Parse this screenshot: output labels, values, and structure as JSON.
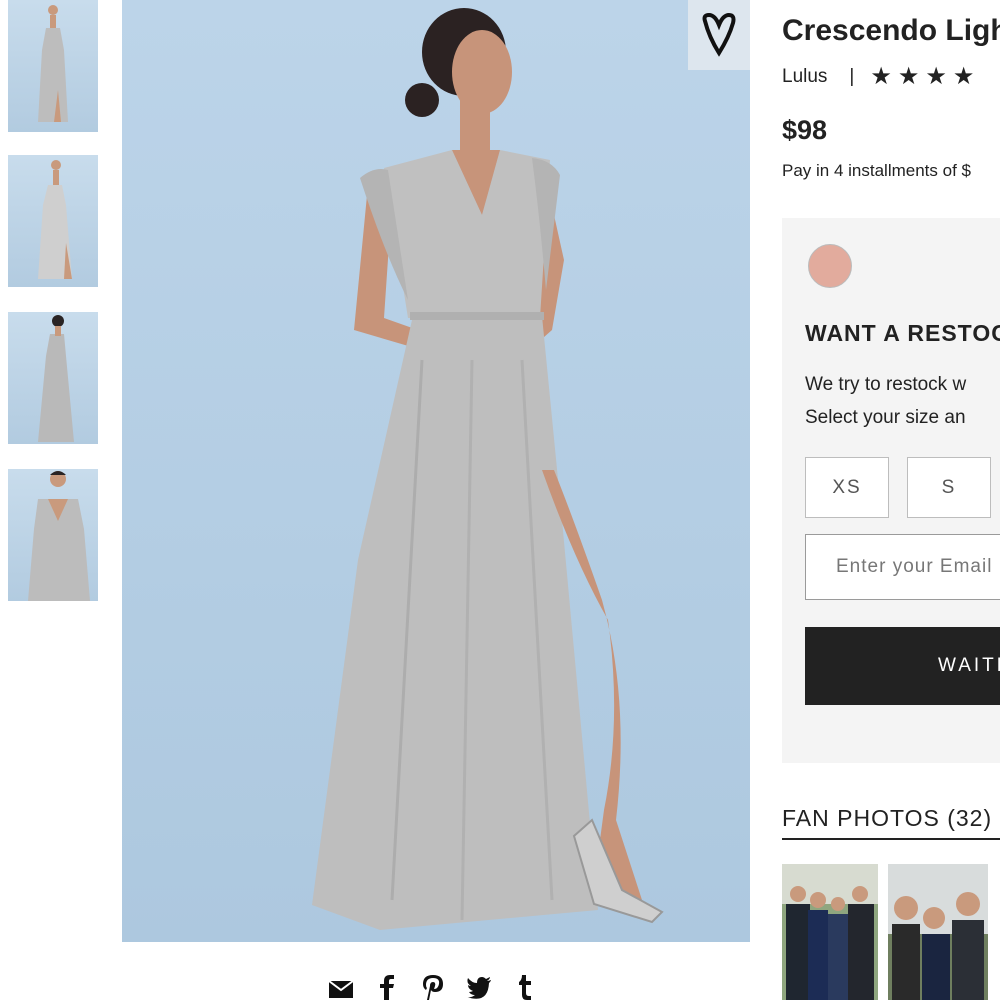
{
  "product": {
    "title": "Crescendo Light",
    "brand": "Lulus",
    "separator": "|",
    "stars": "★★★★",
    "price": "$98",
    "installments": "Pay in 4 installments of $"
  },
  "restock": {
    "swatch_color": "#e2ab9d",
    "title": "WANT A RESTOCK",
    "line1": "We try to restock w",
    "line2": "Select your size an",
    "sizes": [
      "XS",
      "S"
    ],
    "email_placeholder": "Enter your Email",
    "button_label": "WAITLIST"
  },
  "fan_photos": {
    "title": "FAN PHOTOS (32)"
  },
  "share": {
    "icons": [
      "email-icon",
      "facebook-icon",
      "pinterest-icon",
      "twitter-icon",
      "tumblr-icon"
    ]
  },
  "colors": {
    "background_blue": "#b3cde3",
    "dress_gray": "#bebebe",
    "button_dark": "#222222"
  }
}
